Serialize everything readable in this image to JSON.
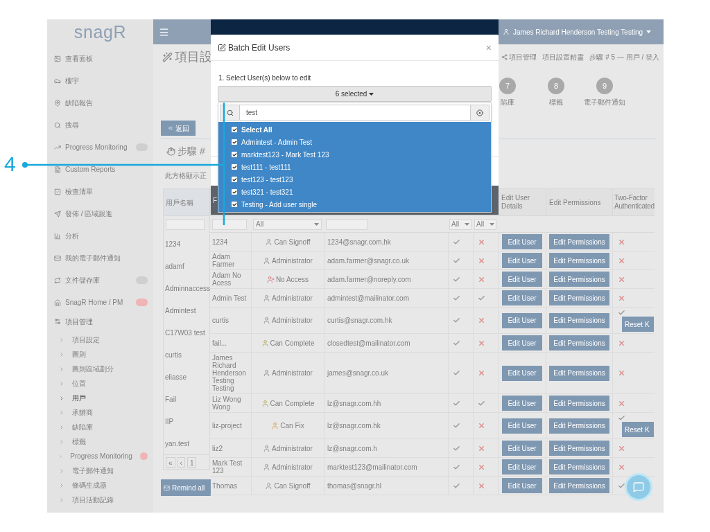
{
  "sidebar": {
    "logo": "snagR",
    "items": [
      {
        "label": "查看面板",
        "kind": "link",
        "selected": false
      },
      {
        "label": "樓宇",
        "kind": "link",
        "selected": false
      },
      {
        "label": "缺陷報告",
        "kind": "link",
        "selected": false
      },
      {
        "label": "搜尋",
        "kind": "link",
        "selected": false
      },
      {
        "label": "Progress Monitoring",
        "kind": "link",
        "selected": false,
        "color": "#cfcfcf"
      },
      {
        "label": "Custom Reports",
        "kind": "link",
        "selected": false
      },
      {
        "label": "檢查清單",
        "kind": "link",
        "selected": false
      },
      {
        "label": "發佈 / 區域跟進",
        "kind": "link",
        "selected": false
      },
      {
        "label": "分析",
        "kind": "link",
        "selected": false
      },
      {
        "label": "我的電子郵件通知",
        "kind": "link",
        "selected": false
      },
      {
        "label": "文件儲存庫",
        "kind": "link",
        "selected": false,
        "color": "#cfcfcf"
      },
      {
        "label": "SnagR Home / PM",
        "kind": "link",
        "selected": false,
        "color": "#f0b4b4"
      },
      {
        "label": "項目管理",
        "kind": "section",
        "selected": false
      },
      {
        "label": "項目設定",
        "kind": "sub",
        "selected": false
      },
      {
        "label": "圖則",
        "kind": "sub",
        "selected": false
      },
      {
        "label": "圖則區域劃分",
        "kind": "sub",
        "selected": false
      },
      {
        "label": "位置",
        "kind": "sub",
        "selected": false
      },
      {
        "label": "用戶",
        "kind": "sub",
        "selected": true
      },
      {
        "label": "承辦商",
        "kind": "sub",
        "selected": false
      },
      {
        "label": "缺陷庫",
        "kind": "sub",
        "selected": false
      },
      {
        "label": "標籤",
        "kind": "sub",
        "selected": false
      },
      {
        "label": "Progress Monitoring",
        "kind": "sub",
        "selected": false,
        "color": "#f0b4b4"
      },
      {
        "label": "電子郵件通知",
        "kind": "sub",
        "selected": false
      },
      {
        "label": "條碼生成器",
        "kind": "sub",
        "selected": false
      },
      {
        "label": "項目活動記錄",
        "kind": "sub",
        "selected": false
      }
    ]
  },
  "header": {
    "user": "James Richard Henderson Testing Testing"
  },
  "page": {
    "title": "項目設",
    "breadcrumb": [
      "項目管理",
      "項目設置精靈",
      "步驟 # 5 — 用戶 / 登入"
    ],
    "steps": [
      {
        "number": "7",
        "label": "陷庫"
      },
      {
        "number": "8",
        "label": "標籤"
      },
      {
        "number": "9",
        "label": "電子郵件通知"
      }
    ],
    "back_button": "返回",
    "section_title": "步驟 #",
    "description": "此方格顯示正"
  },
  "table": {
    "usernames_header": "用戶名稱",
    "usernames": [
      "1234",
      "adamf",
      "Adminnaccess",
      "Admintest",
      "C17W03 test",
      "curtis",
      "eliasse",
      "Fail",
      "IIP",
      "yan.test"
    ],
    "pagination": [
      "«",
      "‹",
      "1"
    ],
    "remind_button": "Remind all",
    "headers": {
      "edit_user": "Edit User Details",
      "edit_permissions": "Edit Permissions",
      "two_factor": "Two-Factor Authenticated"
    },
    "filters": [
      "All",
      "All",
      "All"
    ],
    "rows": [
      {
        "name": "1234",
        "role": "Can Signoff",
        "kind": "signoff",
        "email": "1234@snagr.com.hk",
        "column_5": true,
        "column_6": false,
        "edit_user": "Edit User",
        "edit_permissions": "Edit Permissions",
        "two_factor": false
      },
      {
        "name": "Adam Farmer",
        "role": "Administrator",
        "kind": "admin",
        "email": "adam.farmer@snagr.co.uk",
        "column_5": true,
        "column_6": false,
        "edit_user": "Edit User",
        "edit_permissions": "Edit Permissions",
        "two_factor": false
      },
      {
        "name": "Adam No Acess",
        "role": "No Access",
        "kind": "none",
        "email": "adam.farmer@noreply.com",
        "column_5": true,
        "column_6": false,
        "edit_user": "Edit User",
        "edit_permissions": "Edit Permissions",
        "two_factor": false
      },
      {
        "name": "Admin Test",
        "role": "Administrator",
        "kind": "admin",
        "email": "admintest@mailinator.com",
        "column_5": true,
        "column_6": true,
        "edit_user": "Edit User",
        "edit_permissions": "Edit Permissions",
        "two_factor": false
      },
      {
        "name": "curtis",
        "role": "Administrator",
        "kind": "admin",
        "email": "curtis@snagr.com.hk",
        "column_5": true,
        "column_6": false,
        "edit_user": "Edit User",
        "edit_permissions": "Edit Permissions",
        "two_factor": true,
        "reset": "Reset K"
      },
      {
        "name": "fail...",
        "role": "Can Complete",
        "kind": "complete",
        "email": "closedtest@mailinator.com",
        "column_5": true,
        "column_6": false,
        "edit_user": "Edit User",
        "edit_permissions": "Edit Permissions",
        "two_factor": false
      },
      {
        "name": "James Richard Henderson Testing Testing",
        "role": "Administrator",
        "kind": "admin",
        "email": "james@snagr.co.uk",
        "column_5": true,
        "column_6": false,
        "edit_user": "Edit User",
        "edit_permissions": "Edit Permissions",
        "two_factor": false
      },
      {
        "name": "Liz Wong Wong",
        "role": "Can Complete",
        "kind": "complete",
        "email": "lz@snagr.com.hh",
        "column_5": true,
        "column_6": true,
        "edit_user": "Edit User",
        "edit_permissions": "Edit Permissions",
        "two_factor": false
      },
      {
        "name": "liz-project",
        "role": "Can Fix",
        "kind": "fix",
        "email": "lz@snagr.com.hk",
        "column_5": true,
        "column_6": false,
        "edit_user": "Edit User",
        "edit_permissions": "Edit Permissions",
        "two_factor": true,
        "reset": "Reset K"
      },
      {
        "name": "liz2",
        "role": "Administrator",
        "kind": "admin",
        "email": "lz@snagr.com.h",
        "column_5": true,
        "column_6": false,
        "edit_user": "Edit User",
        "edit_permissions": "Edit Permissions",
        "two_factor": false
      },
      {
        "name": "Mark Test 123",
        "role": "Administrator",
        "kind": "admin",
        "email": "marktest123@mailinator.com",
        "column_5": true,
        "column_6": false,
        "edit_user": "Edit User",
        "edit_permissions": "Edit Permissions",
        "two_factor": false
      },
      {
        "name": "Thomas",
        "role": "Can Signoff",
        "kind": "signoff",
        "email": "thomas@snagr.hl",
        "column_5": true,
        "column_6": false,
        "edit_user": "Edit User",
        "edit_permissions": "Edit Permissions",
        "two_factor": true
      }
    ],
    "header_fragment": "F"
  },
  "modal": {
    "title": "Batch Edit Users",
    "close": "×",
    "step_label": "1. Select User(s) below to edit",
    "dropdown": {
      "label": "6 selected",
      "search_value": "test",
      "options": [
        {
          "label": "Select All",
          "kind": "all",
          "checked": true
        },
        {
          "label": "Admintest - Admin Test",
          "kind": "user",
          "checked": true
        },
        {
          "label": "marktest123 - Mark Test 123",
          "kind": "user",
          "checked": true
        },
        {
          "label": "test111 - test111",
          "kind": "user",
          "checked": true
        },
        {
          "label": "test123 - test123",
          "kind": "user",
          "checked": true
        },
        {
          "label": "test321 - test321",
          "kind": "user",
          "checked": true
        },
        {
          "label": "Testing - Add user single",
          "kind": "user",
          "checked": true
        }
      ]
    }
  },
  "callout": "4"
}
